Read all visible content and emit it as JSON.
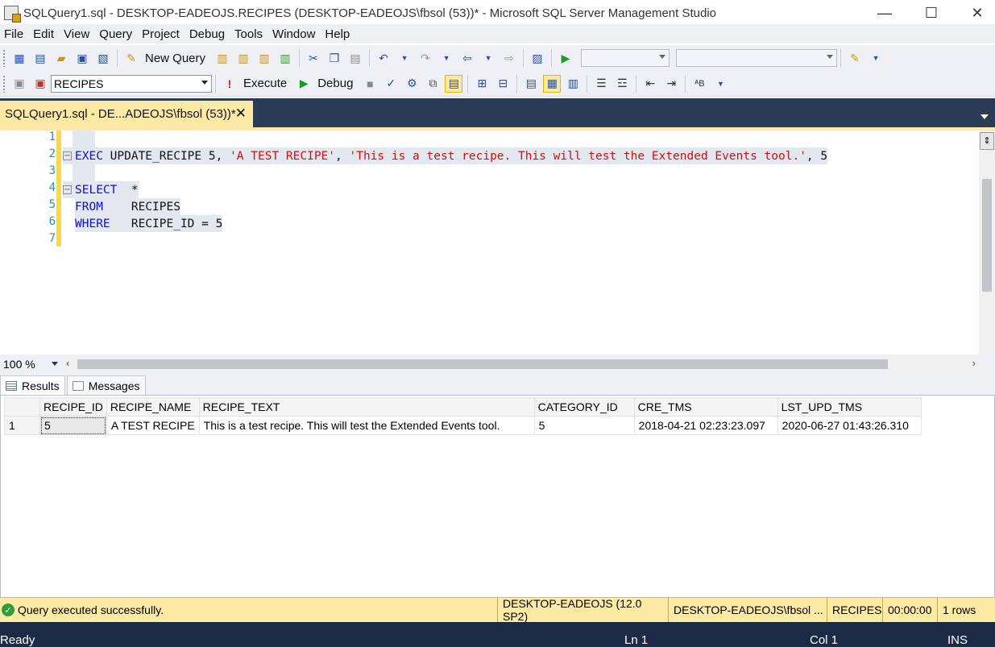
{
  "window": {
    "title": "SQLQuery1.sql - DESKTOP-EADEOJS.RECIPES (DESKTOP-EADEOJS\\fbsol (53))* - Microsoft SQL Server Management Studio",
    "minimize": "—",
    "maximize": "☐",
    "close": "✕"
  },
  "menu": [
    "File",
    "Edit",
    "View",
    "Query",
    "Project",
    "Debug",
    "Tools",
    "Window",
    "Help"
  ],
  "toolbar1": {
    "new_query_label": "New Query"
  },
  "toolbar2": {
    "database": "RECIPES",
    "execute_label": "Execute",
    "debug_label": "Debug"
  },
  "tab": {
    "label": "SQLQuery1.sql - DE...ADEOJS\\fbsol (53))*",
    "close": "✕"
  },
  "editor": {
    "line_numbers": [
      "1",
      "2",
      "3",
      "4",
      "5",
      "6",
      "7"
    ],
    "line2": {
      "kw": "EXEC",
      "text1": " UPDATE_RECIPE 5, ",
      "str1": "'A TEST RECIPE'",
      "text2": ", ",
      "str2": "'This is a test recipe. This will test the Extended Events tool.'",
      "text3": ", 5"
    },
    "line4": {
      "kw": "SELECT",
      "text": "  *"
    },
    "line5": {
      "kw": "FROM",
      "text": "    RECIPES"
    },
    "line6": {
      "kw": "WHERE",
      "text": "   RECIPE_ID = 5"
    },
    "fold_symbol": "−"
  },
  "zoom": "100 %",
  "results_tabs": {
    "results": "Results",
    "messages": "Messages"
  },
  "grid": {
    "columns": [
      "RECIPE_ID",
      "RECIPE_NAME",
      "RECIPE_TEXT",
      "CATEGORY_ID",
      "CRE_TMS",
      "LST_UPD_TMS"
    ],
    "rows": [
      {
        "rownum": "1",
        "cells": [
          "5",
          "A TEST RECIPE",
          "This is a test recipe. This will test the Extended Events tool.",
          "5",
          "2018-04-21 02:23:23.097",
          "2020-06-27 01:43:26.310"
        ]
      }
    ]
  },
  "status": {
    "message": "Query executed successfully.",
    "server": "DESKTOP-EADEOJS (12.0 SP2)",
    "user": "DESKTOP-EADEOJS\\fbsol ...",
    "database": "RECIPES",
    "elapsed": "00:00:00",
    "rows": "1 rows"
  },
  "app_status": {
    "ready": "Ready",
    "ln": "Ln 1",
    "col": "Col 1",
    "ins": "INS"
  },
  "colors": {
    "accent_yellow": "#fde9a6",
    "dark_chrome": "#2b3a55",
    "keyword": "#1010d0",
    "string": "#d01010",
    "line_number": "#2b91af"
  }
}
